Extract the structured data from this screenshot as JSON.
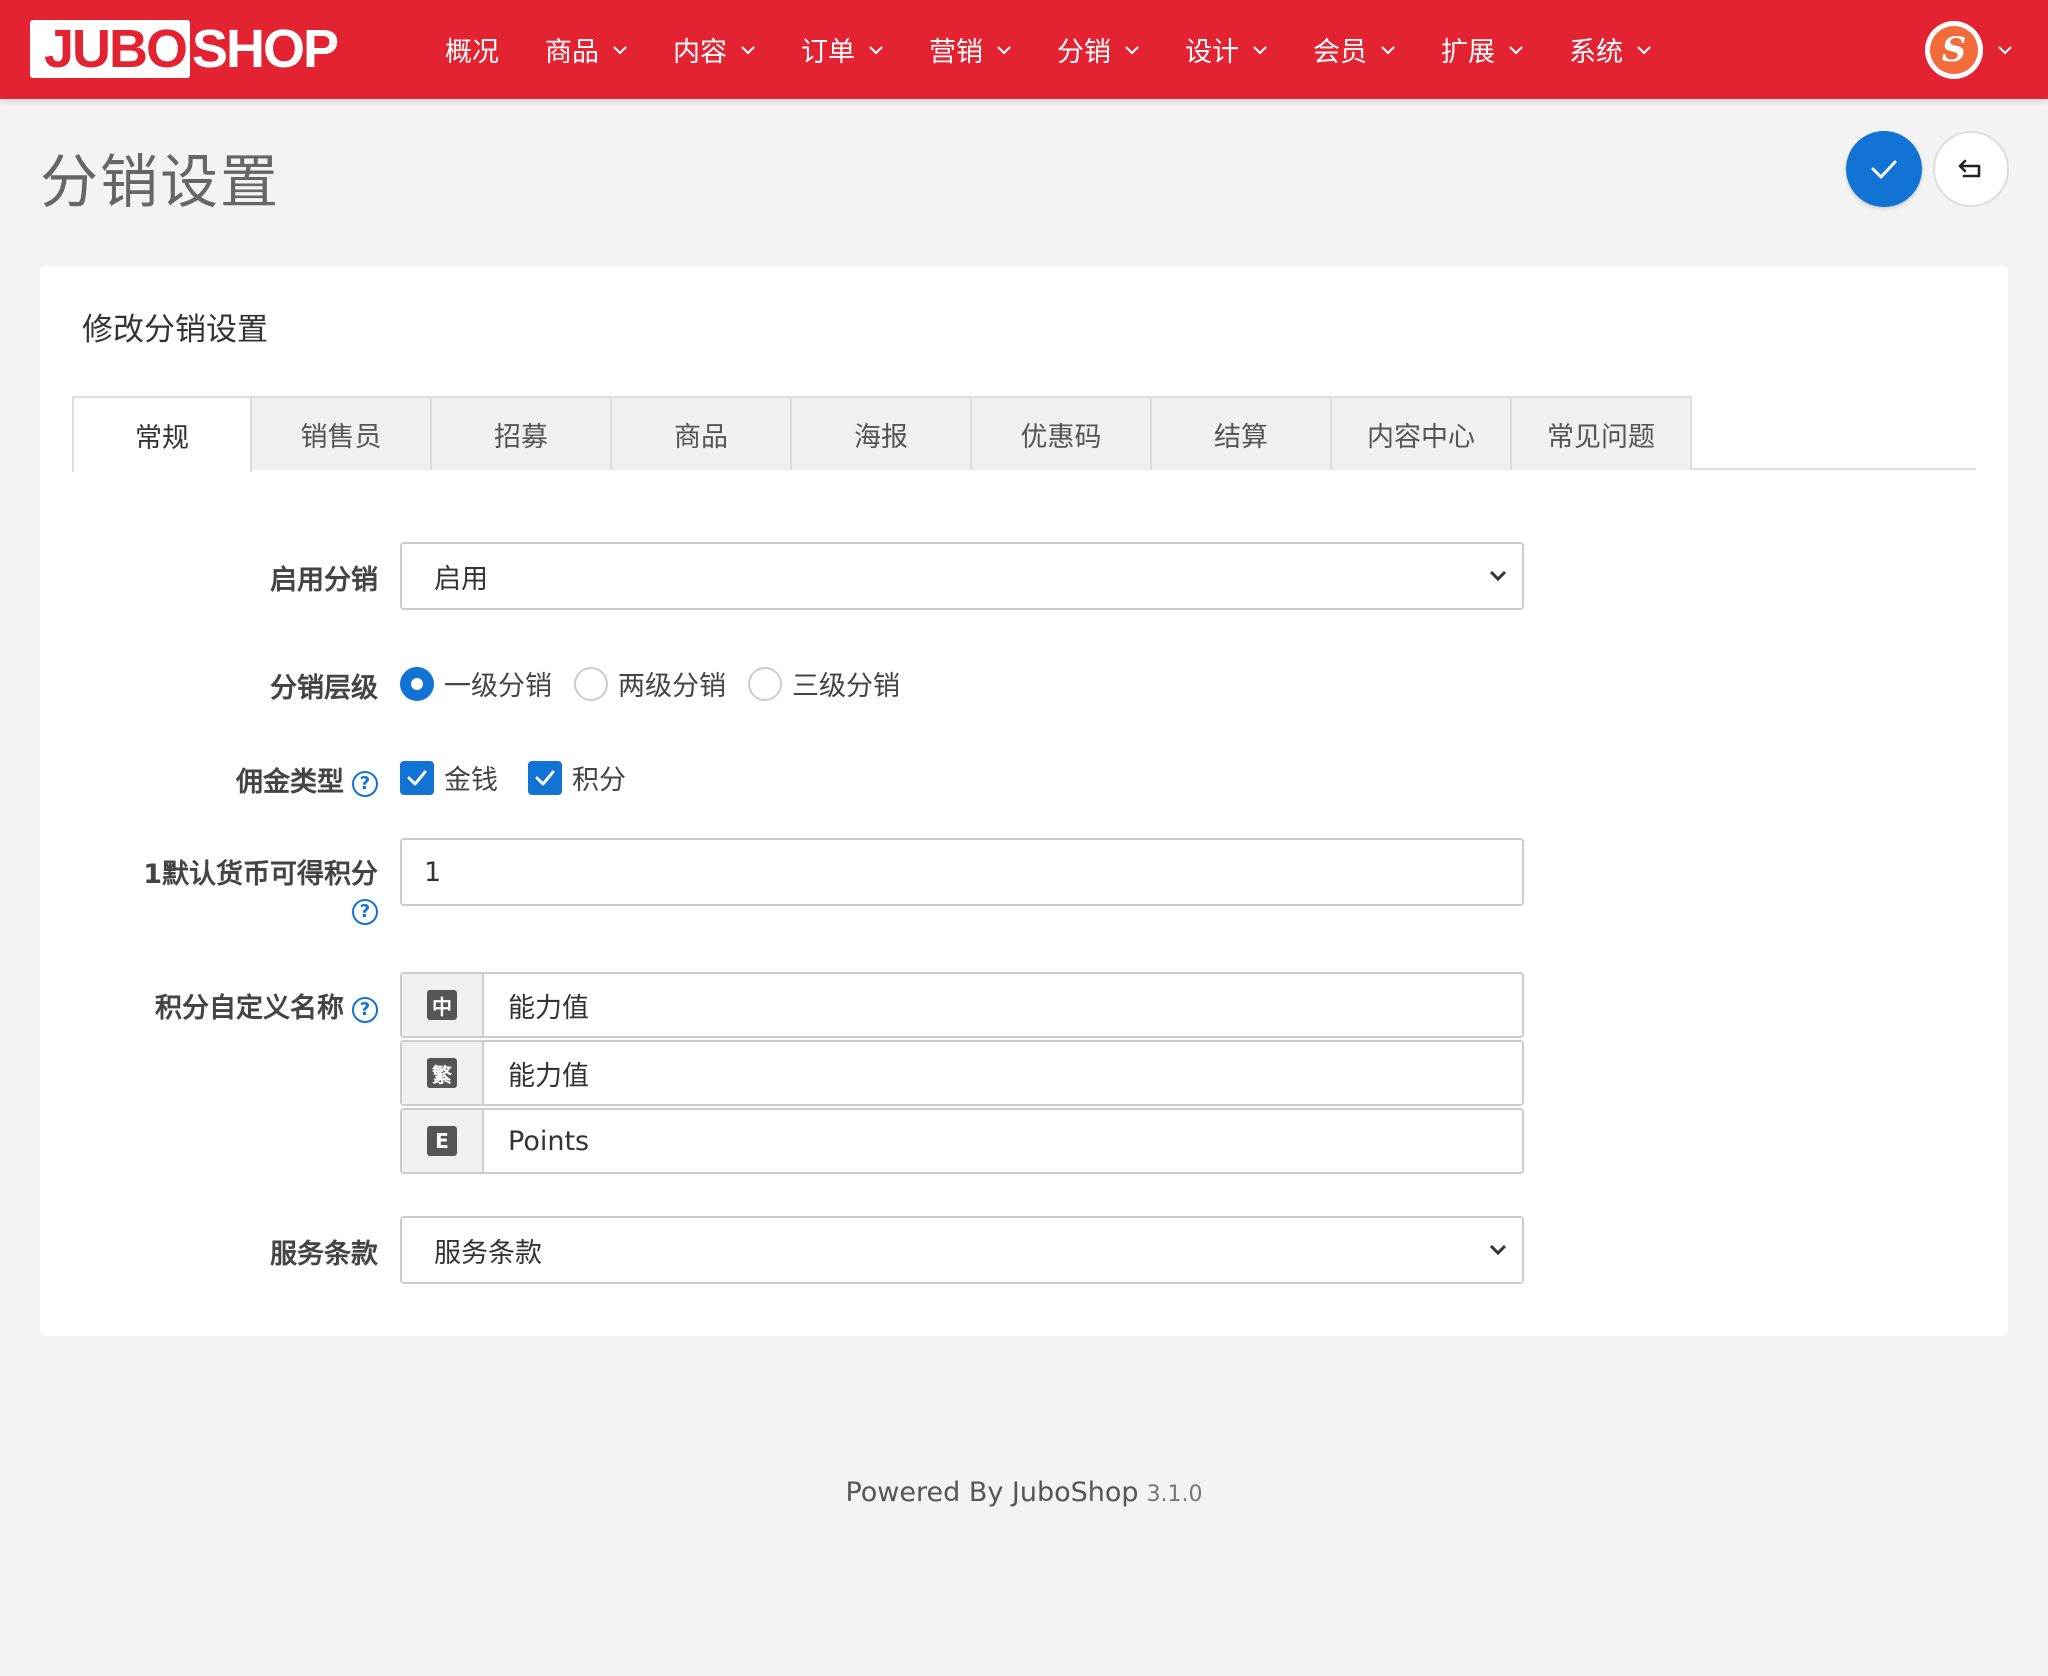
{
  "app": {
    "logo_left": "JUBO",
    "logo_right": "SHOP",
    "nav": [
      {
        "label": "概况",
        "dropdown": false
      },
      {
        "label": "商品",
        "dropdown": true
      },
      {
        "label": "内容",
        "dropdown": true
      },
      {
        "label": "订单",
        "dropdown": true
      },
      {
        "label": "营销",
        "dropdown": true
      },
      {
        "label": "分销",
        "dropdown": true
      },
      {
        "label": "设计",
        "dropdown": true
      },
      {
        "label": "会员",
        "dropdown": true
      },
      {
        "label": "扩展",
        "dropdown": true
      },
      {
        "label": "系统",
        "dropdown": true
      }
    ],
    "avatar_letter": "S"
  },
  "page": {
    "title": "分销设置"
  },
  "card": {
    "title": "修改分销设置",
    "tabs": [
      "常规",
      "销售员",
      "招募",
      "商品",
      "海报",
      "优惠码",
      "结算",
      "内容中心",
      "常见问题"
    ],
    "active_tab": "常规"
  },
  "form": {
    "enable": {
      "label": "启用分销",
      "value": "启用"
    },
    "level": {
      "label": "分销层级",
      "options": [
        "一级分销",
        "两级分销",
        "三级分销"
      ],
      "selected": "一级分销"
    },
    "commission_type": {
      "label": "佣金类型",
      "options": [
        {
          "label": "金钱",
          "checked": true
        },
        {
          "label": "积分",
          "checked": true
        }
      ]
    },
    "points_rate": {
      "label": "1默认货币可得积分",
      "value": "1"
    },
    "points_name": {
      "label": "积分自定义名称",
      "langs": [
        {
          "badge": "中",
          "value": "能力值"
        },
        {
          "badge": "繁",
          "value": "能力值"
        },
        {
          "badge": "E",
          "value": "Points"
        }
      ]
    },
    "terms": {
      "label": "服务条款",
      "value": "服务条款"
    }
  },
  "footer": {
    "text": "Powered By JuboShop",
    "version": "3.1.0"
  },
  "colors": {
    "brand_red": "#e42332",
    "primary_blue": "#1173d4"
  }
}
